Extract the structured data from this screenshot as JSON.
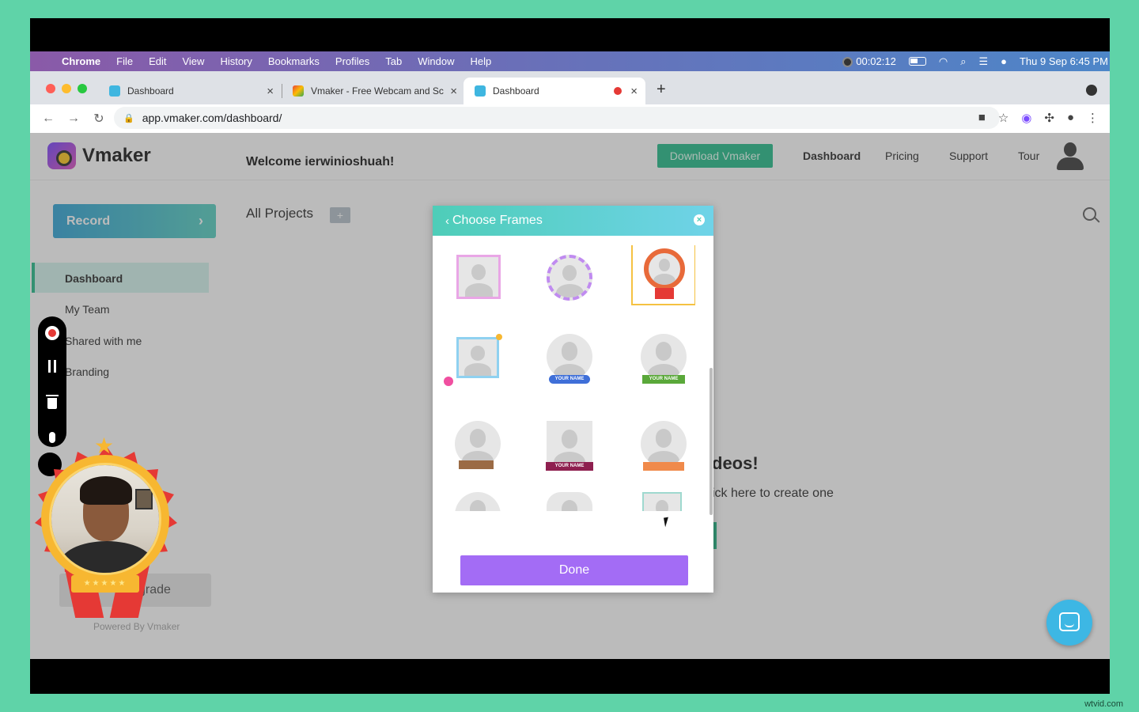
{
  "menubar": {
    "app": "Chrome",
    "items": [
      "File",
      "Edit",
      "View",
      "History",
      "Bookmarks",
      "Profiles",
      "Tab",
      "Window",
      "Help"
    ],
    "timer": "00:02:12",
    "datetime": "Thu 9 Sep  6:45 PM"
  },
  "browser": {
    "tabs": [
      {
        "title": "Dashboard"
      },
      {
        "title": "Vmaker - Free Webcam and Sc"
      },
      {
        "title": "Dashboard"
      }
    ],
    "url": "app.vmaker.com/dashboard/"
  },
  "header": {
    "brand": "Vmaker",
    "download": "Download Vmaker",
    "nav": [
      "Dashboard",
      "Pricing",
      "Support",
      "Tour"
    ]
  },
  "sidebar": {
    "record": "Record",
    "items": [
      "Dashboard",
      "My Team",
      "Shared with me",
      "Branding"
    ],
    "upgrade": "grade",
    "powered": "Powered By Vmaker"
  },
  "main": {
    "welcome": "Welcome ierwinioshuah!",
    "all_projects": "All Projects",
    "empty_title": "deos!",
    "empty_sub": "ick here to create one"
  },
  "modal": {
    "title": "Choose Frames",
    "done": "Done",
    "banner_text": "YOUR NAME"
  },
  "watermark": "wtvid.com"
}
